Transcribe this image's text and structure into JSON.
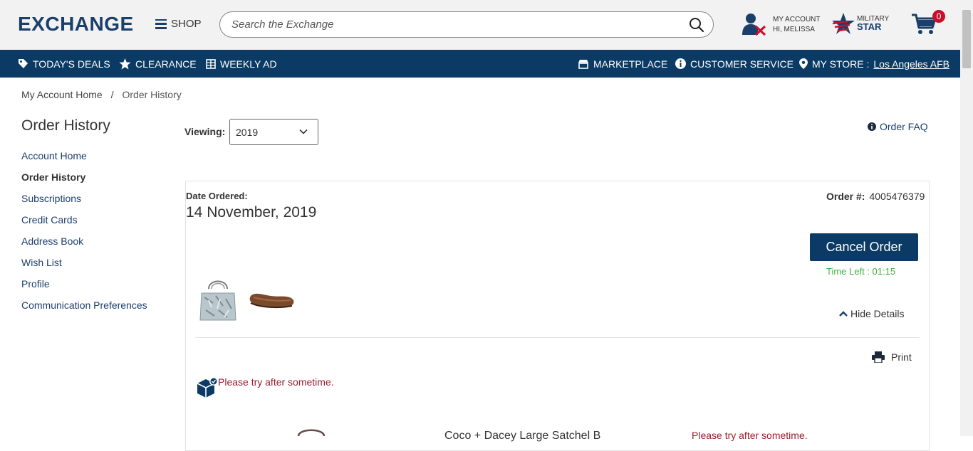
{
  "header": {
    "logo_text": "EXCHANGE",
    "shop_label": "SHOP",
    "search_placeholder": "Search the Exchange",
    "account_line1": "MY ACCOUNT",
    "account_line2": "HI, MELISSA",
    "military_line1": "MILITARY",
    "military_line2": "STAR",
    "cart_count": "0"
  },
  "nav": {
    "todays_deals": "TODAY'S DEALS",
    "clearance": "CLEARANCE",
    "weekly_ad": "WEEKLY AD",
    "marketplace": "MARKETPLACE",
    "customer_service": "CUSTOMER SERVICE",
    "my_store_label": "MY STORE :",
    "my_store_value": "Los Angeles AFB"
  },
  "breadcrumb": {
    "home": "My Account Home",
    "separator": "/",
    "current": "Order History"
  },
  "sidebar": {
    "title": "Order History",
    "items": [
      {
        "label": "Account Home"
      },
      {
        "label": "Order History"
      },
      {
        "label": "Subscriptions"
      },
      {
        "label": "Credit Cards"
      },
      {
        "label": "Address Book"
      },
      {
        "label": "Wish List"
      },
      {
        "label": "Profile"
      },
      {
        "label": "Communication Preferences"
      }
    ]
  },
  "filters": {
    "viewing_label": "Viewing:",
    "year_selected": "2019",
    "faq_label": "Order FAQ"
  },
  "order": {
    "date_label": "Date Ordered:",
    "date_value": "14 November, 2019",
    "number_label": "Order #:",
    "number_value": "4005476379",
    "cancel_label": "Cancel Order",
    "time_left": "Time Left : 01:15",
    "hide_details_label": "Hide Details",
    "print_label": "Print",
    "status_message": "Please try after sometime.",
    "item_title": "Coco + Dacey Large Satchel B",
    "item_message": "Please try after sometime."
  },
  "colors": {
    "brand_navy": "#0b3b64",
    "brand_red": "#c8102e",
    "success_green": "#3cb043",
    "error_red": "#9b1c2c"
  }
}
